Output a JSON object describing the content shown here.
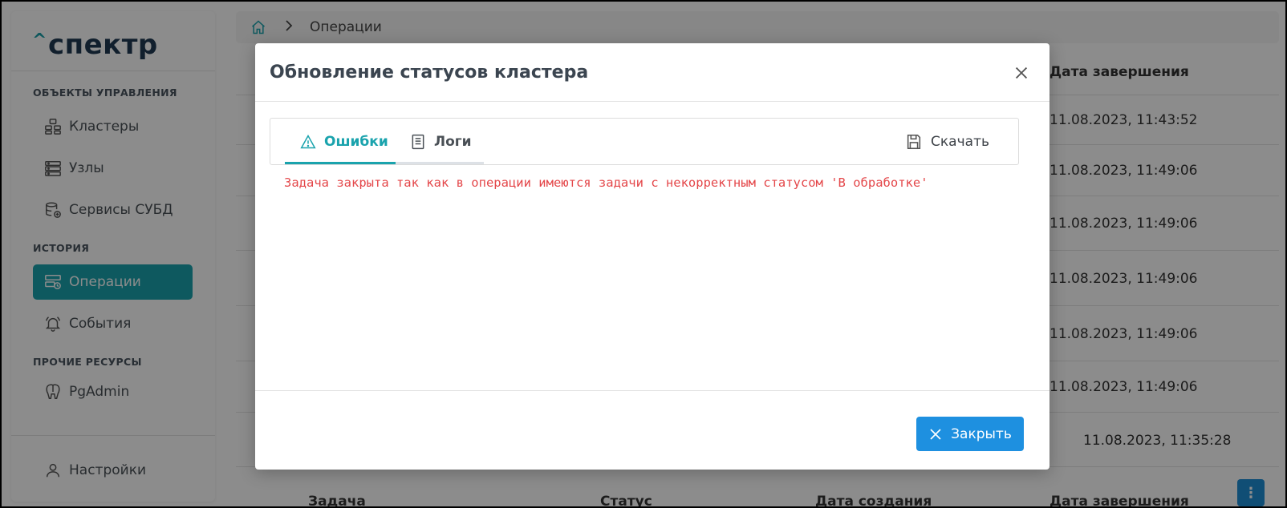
{
  "sidebar": {
    "logo": "спектр",
    "logo_caret": "^",
    "sections": [
      "ОБЪЕКТЫ УПРАВЛЕНИЯ",
      "ИСТОРИЯ",
      "ПРОЧИЕ РЕСУРСЫ"
    ],
    "items": [
      {
        "label": "Кластеры",
        "icon": "clusters-icon"
      },
      {
        "label": "Узлы",
        "icon": "server-icon"
      },
      {
        "label": "Сервисы СУБД",
        "icon": "database-icon"
      },
      {
        "label": "Операции",
        "icon": "operations-icon",
        "active": true
      },
      {
        "label": "События",
        "icon": "bell-icon"
      },
      {
        "label": "PgAdmin",
        "icon": "elephant-icon"
      },
      {
        "label": "Настройки",
        "icon": "user-icon"
      }
    ]
  },
  "breadcrumb": {
    "current": "Операции"
  },
  "background_table": {
    "headers": {
      "end_date": "Дата завершения"
    },
    "end_dates": [
      "11.08.2023, 11:43:52",
      "11.08.2023, 11:49:06",
      "11.08.2023, 11:49:06",
      "11.08.2023, 11:49:06",
      "11.08.2023, 11:49:06",
      "11.08.2023, 11:49:06",
      "11.08.2023, 11:35:28"
    ],
    "footer_headers": [
      "Задача",
      "Статус",
      "Дата создания",
      "Дата завершения"
    ]
  },
  "modal": {
    "title": "Обновление статусов кластера",
    "tabs": [
      {
        "label": "Ошибки",
        "active": true
      },
      {
        "label": "Логи",
        "active": false
      }
    ],
    "download_label": "Скачать",
    "error_message": "Задача закрыта так как в операции имеются задачи с некорректным статусом 'В обработке'",
    "close_label": "Закрыть"
  },
  "colors": {
    "accent": "#1aa3ad",
    "primary_button": "#1e90e0",
    "error_text": "#e4474a"
  }
}
